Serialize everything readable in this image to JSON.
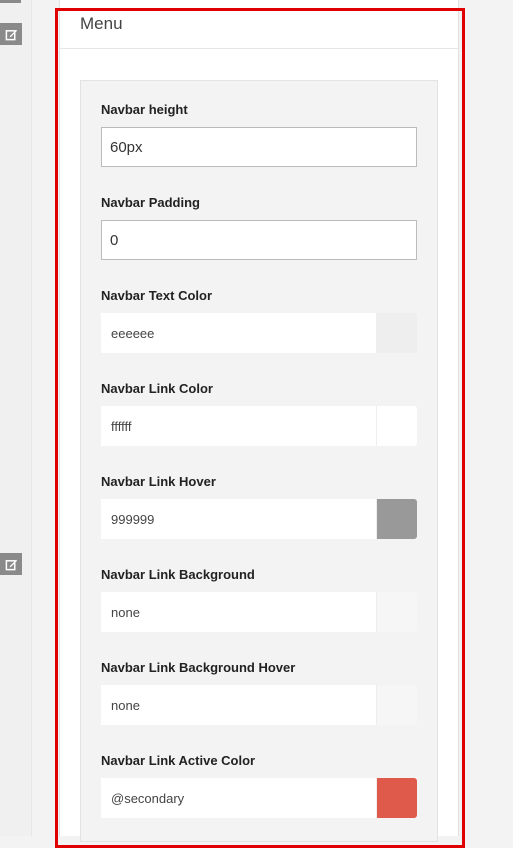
{
  "panel": {
    "title": "Menu"
  },
  "fields": {
    "navbar_height": {
      "label": "Navbar height",
      "value": "60px"
    },
    "navbar_padding": {
      "label": "Navbar Padding",
      "value": "0"
    },
    "navbar_text_color": {
      "label": "Navbar Text Color",
      "value": "eeeeee",
      "swatch": "#eeeeee"
    },
    "navbar_link_color": {
      "label": "Navbar Link Color",
      "value": "ffffff",
      "swatch": "#ffffff"
    },
    "navbar_link_hover": {
      "label": "Navbar Link Hover",
      "value": "999999",
      "swatch": "#999999"
    },
    "navbar_link_background": {
      "label": "Navbar Link Background",
      "value": "none",
      "swatch": "#f6f6f6"
    },
    "navbar_link_background_hover": {
      "label": "Navbar Link Background Hover",
      "value": "none",
      "swatch": "#f6f6f6"
    },
    "navbar_link_active_color": {
      "label": "Navbar Link Active Color",
      "value": "@secondary",
      "swatch": "#e05a4b"
    }
  },
  "colors": {
    "highlight": "#e00000",
    "icon_bg": "#8a8a8a"
  }
}
